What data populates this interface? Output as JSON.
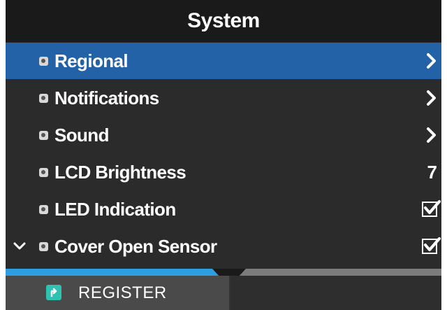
{
  "header": {
    "title": "System"
  },
  "rows": [
    {
      "label": "Regional",
      "right": "›",
      "right_type": "arrow"
    },
    {
      "label": "Notifications",
      "right": "›",
      "right_type": "arrow"
    },
    {
      "label": "Sound",
      "right": "›",
      "right_type": "arrow"
    },
    {
      "label": "LCD Brightness",
      "right": "7",
      "right_type": "value"
    },
    {
      "label": "LED Indication",
      "right_type": "checkbox",
      "checked": true
    },
    {
      "label": "Cover Open Sensor",
      "right_type": "checkbox",
      "checked": true
    }
  ],
  "selected_row": "Regional",
  "scroll_progress": 0.5,
  "footer": {
    "register_label": "REGISTER"
  },
  "icons": {
    "lock": "lock-icon",
    "arrow": "chevron-right-icon",
    "expand": "chevron-down-icon",
    "register": "register-icon"
  },
  "colors": {
    "selected": "#2362a6",
    "background": "#2b2b2b",
    "progress": "#2d9ee2",
    "register_icon": "#2ec2b3"
  }
}
